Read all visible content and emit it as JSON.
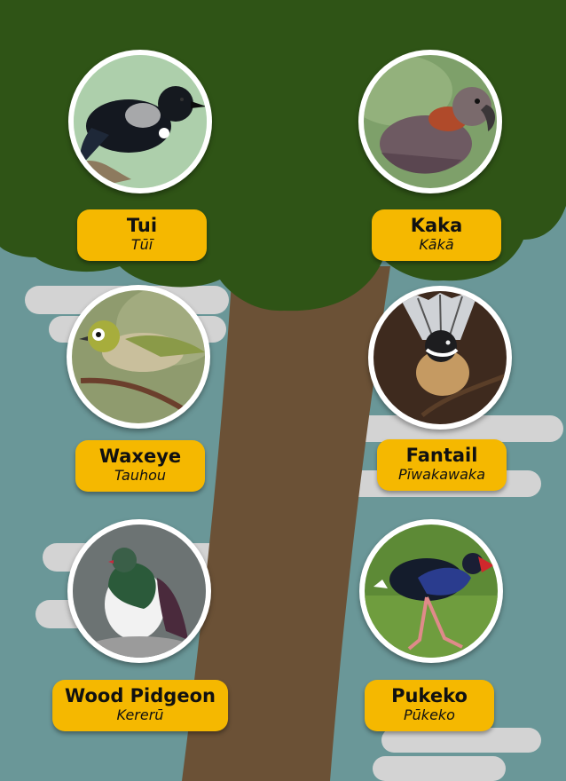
{
  "colors": {
    "sky": "#6a9798",
    "canopy": "#2f5416",
    "trunk": "#6b5136",
    "cloud": "#d3d3d3",
    "label_bg": "#f5b800",
    "frame": "#ffffff"
  },
  "birds": {
    "tui": {
      "en": "Tui",
      "mi": "Tūī"
    },
    "kaka": {
      "en": "Kaka",
      "mi": "Kākā"
    },
    "waxeye": {
      "en": "Waxeye",
      "mi": "Tauhou"
    },
    "fantail": {
      "en": "Fantail",
      "mi": "Pīwakawaka"
    },
    "pigeon": {
      "en": "Wood Pidgeon",
      "mi": "Kererū"
    },
    "pukeko": {
      "en": "Pukeko",
      "mi": "Pūkeko"
    }
  }
}
